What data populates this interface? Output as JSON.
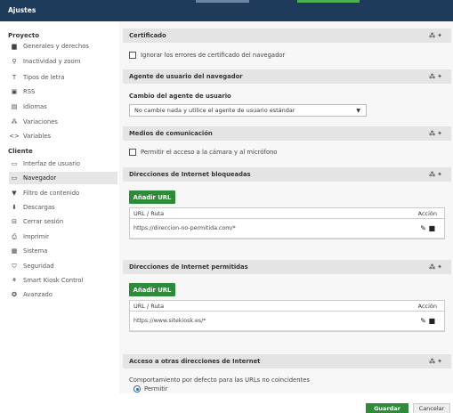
{
  "window": {
    "title": "Ajustes"
  },
  "sidebar": {
    "section1": "Proyecto",
    "items1": [
      {
        "label": "Generales y derechos",
        "icon": "folder-icon"
      },
      {
        "label": "Inactividad y zoom",
        "icon": "zoom-icon"
      },
      {
        "label": "Tipos de letra",
        "icon": "font-icon"
      },
      {
        "label": "RSS",
        "icon": "rss-icon"
      },
      {
        "label": "Idiomas",
        "icon": "language-icon"
      },
      {
        "label": "Variaciones",
        "icon": "variations-icon"
      },
      {
        "label": "Variables",
        "icon": "code-icon"
      }
    ],
    "section2": "Cliente",
    "items2": [
      {
        "label": "Interfaz de usuario",
        "icon": "ui-icon"
      },
      {
        "label": "Navegador",
        "icon": "browser-icon"
      },
      {
        "label": "Filtro de contenido",
        "icon": "filter-icon"
      },
      {
        "label": "Descargas",
        "icon": "download-icon"
      },
      {
        "label": "Cerrar sesión",
        "icon": "logout-icon"
      },
      {
        "label": "Imprimir",
        "icon": "print-icon"
      },
      {
        "label": "Sistema",
        "icon": "system-icon"
      },
      {
        "label": "Seguridad",
        "icon": "security-icon"
      },
      {
        "label": "Smart Kiosk Control",
        "icon": "kiosk-icon"
      },
      {
        "label": "Avanzado",
        "icon": "advanced-icon"
      }
    ]
  },
  "sections": {
    "cert": {
      "title": "Certificado",
      "checkbox": "Ignorar los errores de certificado del navegador"
    },
    "ua": {
      "title": "Agente de usuario del navegador",
      "label": "Cambio del agente de usuario",
      "select": "No cambie nada y utilice el agente de usuario estándar"
    },
    "media": {
      "title": "Medios de comunicación",
      "checkbox": "Permitir el acceso a la cámara y al micrófono"
    },
    "blocked": {
      "title": "Direcciones de Internet bloqueadas",
      "add": "Añadir URL",
      "col1": "URL / Ruta",
      "col2": "Acción",
      "url": "https://direccion-no-permitida.com/*"
    },
    "allowed": {
      "title": "Direcciones de Internet permitidas",
      "add": "Añadir URL",
      "col1": "URL / Ruta",
      "col2": "Acción",
      "url": "https://www.sitekiosk.es/*"
    },
    "other": {
      "title": "Acceso a otras direcciones de Internet",
      "label": "Comportamiento por defecto para las URLs no coincidentes",
      "radio": "Permitir"
    }
  },
  "footer": {
    "save": "Guardar",
    "cancel": "Cancelar"
  },
  "colors": {
    "titlebar": "#1f3b5c",
    "accent": "#2e8b3a"
  }
}
